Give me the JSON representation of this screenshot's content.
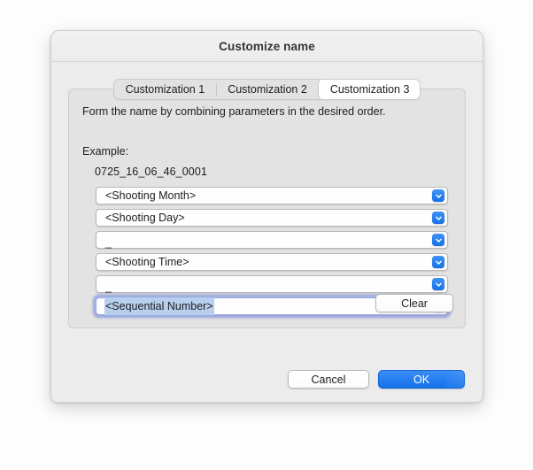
{
  "dialog": {
    "title": "Customize name"
  },
  "tabs": [
    {
      "label": "Customization 1",
      "active": false
    },
    {
      "label": "Customization 2",
      "active": false
    },
    {
      "label": "Customization 3",
      "active": true
    }
  ],
  "panel": {
    "description": "Form the name by combining parameters in the desired order.",
    "example_label": "Example:",
    "example_value": "0725_16_06_46_0001",
    "rows": [
      {
        "value": "<Shooting Month>",
        "focused": false,
        "icon": "chevron-down-icon"
      },
      {
        "value": "<Shooting Day>",
        "focused": false,
        "icon": "chevron-down-icon"
      },
      {
        "value": "_",
        "focused": false,
        "icon": "chevron-down-icon"
      },
      {
        "value": "<Shooting Time>",
        "focused": false,
        "icon": "chevron-down-icon"
      },
      {
        "value": "_",
        "focused": false,
        "icon": "chevron-down-icon"
      },
      {
        "value": "<Sequential Number>",
        "focused": true,
        "icon": "chevron-down-icon"
      }
    ],
    "clear_label": "Clear"
  },
  "footer": {
    "cancel_label": "Cancel",
    "ok_label": "OK"
  },
  "colors": {
    "accent_blue": "#1471ea",
    "focus_ring": "#7a8adc",
    "selection_blue": "#b8cfee",
    "dialog_bg": "#ececec",
    "panel_bg": "#e3e3e3"
  }
}
